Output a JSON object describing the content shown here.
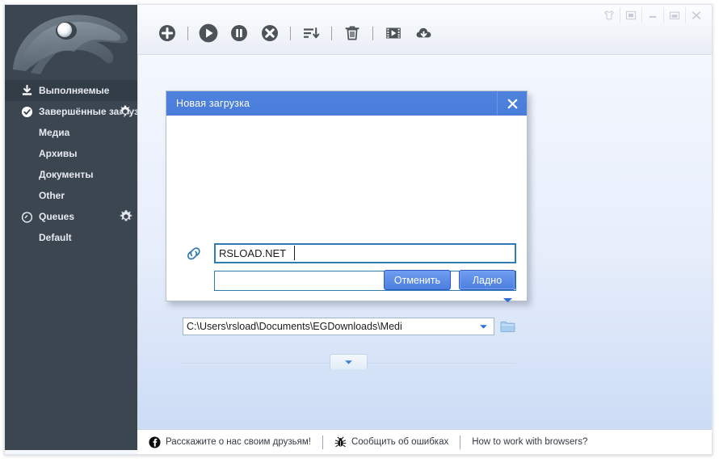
{
  "window": {
    "controls": [
      {
        "name": "skin-button",
        "icon": "shirt-icon"
      },
      {
        "name": "tray-button",
        "icon": "minimize-to-tray-icon"
      },
      {
        "name": "minimize-button",
        "icon": "minimize-icon"
      },
      {
        "name": "maximize-button",
        "icon": "maximize-icon"
      },
      {
        "name": "close-button",
        "icon": "close-icon"
      }
    ]
  },
  "sidebar": {
    "logo": "eagle-logo",
    "items": [
      {
        "label": "Выполняемые",
        "icon": "download-tray-icon",
        "selected": true,
        "child": false,
        "gear": false
      },
      {
        "label": "Завершённые загрузки",
        "icon": "check-circle-icon",
        "selected": false,
        "child": false,
        "gear": true
      },
      {
        "label": "Медиа",
        "icon": "",
        "selected": false,
        "child": true,
        "gear": false
      },
      {
        "label": "Архивы",
        "icon": "",
        "selected": false,
        "child": true,
        "gear": false
      },
      {
        "label": "Документы",
        "icon": "",
        "selected": false,
        "child": true,
        "gear": false
      },
      {
        "label": "Other",
        "icon": "",
        "selected": false,
        "child": true,
        "gear": false
      },
      {
        "label": "Queues",
        "icon": "clock-icon",
        "selected": false,
        "child": false,
        "gear": true
      },
      {
        "label": "Default",
        "icon": "",
        "selected": false,
        "child": true,
        "gear": false
      }
    ]
  },
  "toolbar": {
    "buttons": [
      {
        "name": "add-download-button",
        "icon": "plus-circle-icon"
      },
      {
        "name": "start-button",
        "icon": "play-circle-icon"
      },
      {
        "name": "pause-button",
        "icon": "pause-circle-icon"
      },
      {
        "name": "stop-button",
        "icon": "stop-circle-icon"
      },
      {
        "name": "sort-button",
        "icon": "sort-descending-icon"
      },
      {
        "name": "delete-button",
        "icon": "trash-icon"
      },
      {
        "name": "media-grabber-button",
        "icon": "film-icon"
      },
      {
        "name": "downloads-button",
        "icon": "cloud-download-icon"
      }
    ]
  },
  "dialog": {
    "title": "Новая загрузка",
    "close_icon": "close-icon",
    "link_icon": "link-chain-icon",
    "url_value": "RSLOAD.NET",
    "url_placeholder": "",
    "description_value": "",
    "description_placeholder": "",
    "history_arrow_icon": "chevron-down-icon",
    "path_value": "C:\\Users\\rsload\\Documents\\EGDownloads\\Medi",
    "path_dropdown_icon": "chevron-down-icon",
    "browse_icon": "folder-icon",
    "expander_icon": "chevron-down-icon",
    "cancel_label": "Отменить",
    "ok_label": "Ладно"
  },
  "statusbar": {
    "items": [
      {
        "name": "share-link",
        "icon": "facebook-icon",
        "label": "Расскажите о нас своим друзьям!"
      },
      {
        "name": "report-bug",
        "icon": "bug-icon",
        "label": "Сообщить об ошибках"
      },
      {
        "name": "browsers-help",
        "icon": "",
        "label": "How to work with browsers?"
      }
    ]
  },
  "colors": {
    "sidebar_bg": "#3b4651",
    "sidebar_selected": "#333d48",
    "accent_blue": "#4a7ddb",
    "dialog_focus_border": "#2f7cb0",
    "content_top": "#f3f7fe",
    "content_bottom": "#ccdcf5"
  }
}
